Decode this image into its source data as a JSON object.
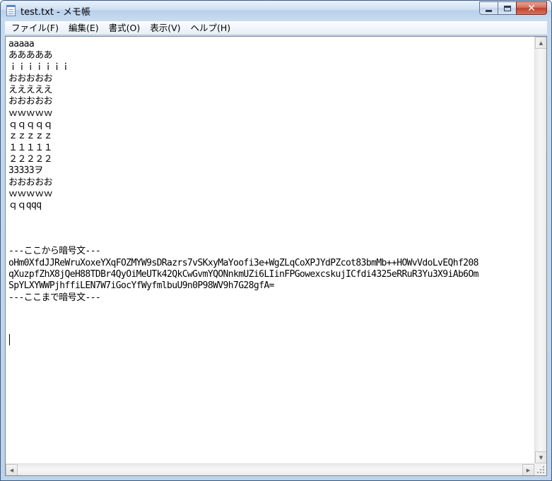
{
  "window": {
    "title": "test.txt - メモ帳",
    "minimize_glyph": "",
    "maximize_glyph": "",
    "close_glyph": "✕"
  },
  "menu": {
    "file": "ファイル(F)",
    "edit": "編集(E)",
    "format": "書式(O)",
    "view": "表示(V)",
    "help": "ヘルプ(H)"
  },
  "document": {
    "text": "aaaaa\nあああああ\nｉｉｉｉｉｉｉ\nおおおおお\nえええええ\nおおおおお\nｗｗｗｗｗ\nｑｑｑｑｑ\nｚｚｚｚｚ\n１１１１１\n２２２２２\n33333ヲ\nおおおおお\nｗｗｗｗｗ\nｑｑqqq\n\n\n\n---ここから暗号文---\noHm0XfdJJReWruXoxeYXqFOZMYW9sDRazrs7vSKxyMaYoofi3e+WgZLqCoXPJYdPZcot83bmMb++HOWvVdoLvEQhf208\nqXuzpfZhX8jQeH88TDBr4QyOiMeUTk42QkCwGvmYQONnkmUZi6LIinFPGowexcskujICfdi4325eRRuR3Yu3X9iAb6Om\nSpYLXYWWPjhffiLEN7W7iGocYfWyfmlbuU9n0P98WV9h7G28gfA=\n---ここまで暗号文---"
  },
  "scrollbar": {
    "up_arrow": "▲",
    "down_arrow": "▼",
    "left_arrow": "◀",
    "right_arrow": "▶"
  },
  "colors": {
    "titlebar": "#c5d9ee",
    "close_button": "#c2412c",
    "edit_background": "#ffffff"
  }
}
